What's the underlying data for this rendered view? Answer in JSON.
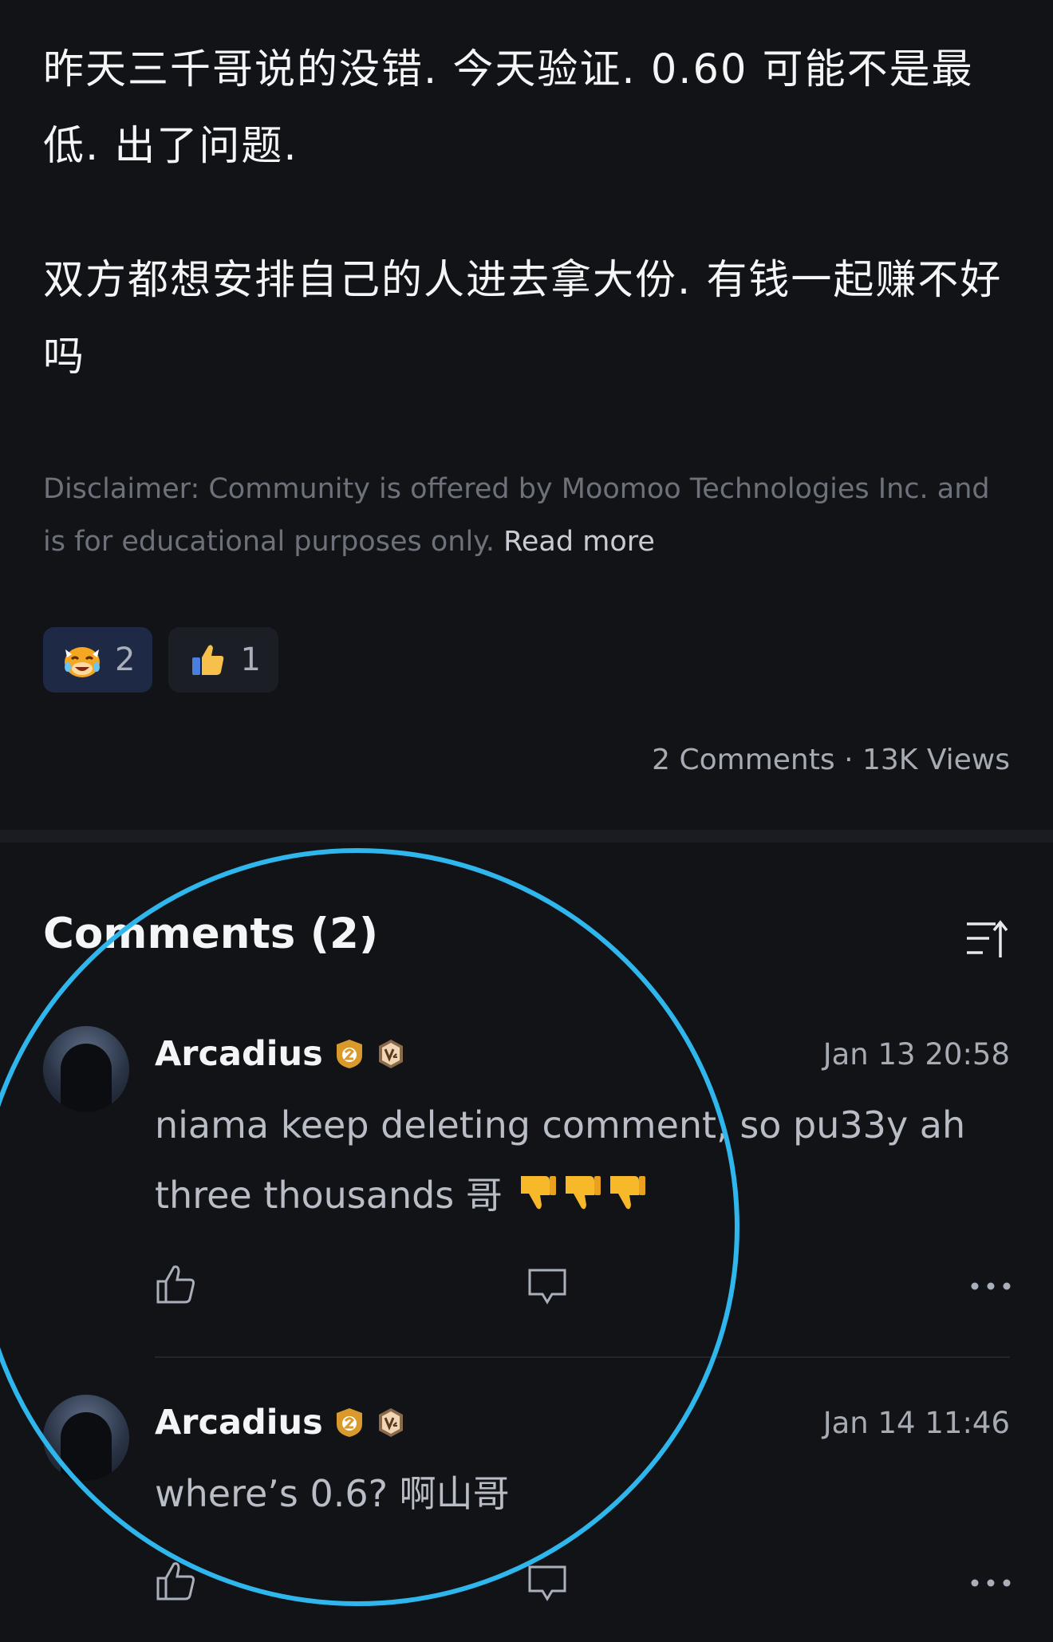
{
  "post": {
    "paragraph1": "昨天三千哥说的没错. 今天验证. 0.60 可能不是最低. 出了问题.",
    "paragraph2": "双方都想安排自己的人进去拿大份.  有钱一起赚不好吗"
  },
  "disclaimer": {
    "text": "Disclaimer: Community is offered by Moomoo Technologies Inc. and is for educational purposes only. ",
    "read_more": "Read more"
  },
  "reactions": [
    {
      "icon": "laughing-cow-emoji-icon",
      "count": "2",
      "active": true
    },
    {
      "icon": "thumbs-up-emoji-icon",
      "count": "1",
      "active": false
    }
  ],
  "stats": "2 Comments · 13K Views",
  "comments_section": {
    "title": "Comments (2)",
    "sort_icon": "sort-icon"
  },
  "comments": [
    {
      "author": "Arcadius",
      "time": "Jan 13 20:58",
      "body": "niama keep deleting comment, so pu33y ah three thousands 哥 ",
      "emojis": [
        "thumbs-down-emoji-icon",
        "thumbs-down-emoji-icon",
        "thumbs-down-emoji-icon"
      ],
      "badges": [
        "level-2-shield-badge-icon",
        "v2-badge-icon"
      ]
    },
    {
      "author": "Arcadius",
      "time": "Jan 14 11:46",
      "body": "where’s 0.6? 啊山哥",
      "emojis": [],
      "badges": [
        "level-2-shield-badge-icon",
        "v2-badge-icon"
      ]
    }
  ],
  "colors": {
    "background": "#111317",
    "highlight_circle": "#2fb6ec",
    "badge_gold": "#d99a2b"
  }
}
